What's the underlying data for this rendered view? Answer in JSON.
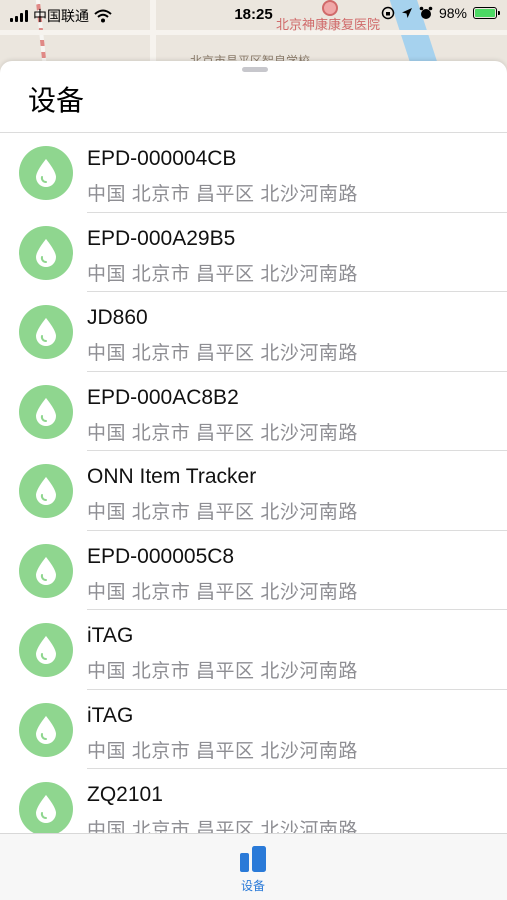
{
  "status_bar": {
    "carrier": "中国联通",
    "time": "18:25",
    "battery": "98%",
    "battery_level": 0.98
  },
  "map": {
    "poi_label": "北京神康康复医院",
    "road_label": "北京市昌平区智良学校"
  },
  "sheet": {
    "title": "设备"
  },
  "devices": [
    {
      "name": "EPD-000004CB",
      "address": "中国 北京市 昌平区 北沙河南路"
    },
    {
      "name": "EPD-000A29B5",
      "address": "中国 北京市 昌平区 北沙河南路"
    },
    {
      "name": "JD860",
      "address": "中国 北京市 昌平区 北沙河南路"
    },
    {
      "name": "EPD-000AC8B2",
      "address": "中国 北京市 昌平区 北沙河南路"
    },
    {
      "name": "ONN Item Tracker",
      "address": "中国 北京市 昌平区 北沙河南路"
    },
    {
      "name": "EPD-000005C8",
      "address": "中国 北京市 昌平区 北沙河南路"
    },
    {
      "name": "iTAG",
      "address": "中国 北京市 昌平区 北沙河南路"
    },
    {
      "name": "iTAG",
      "address": "中国 北京市 昌平区 北沙河南路"
    },
    {
      "name": "ZQ2101",
      "address": "中国 北京市 昌平区 北沙河南路"
    }
  ],
  "tab_bar": {
    "tabs": [
      {
        "label": "设备",
        "icon": "devices-icon",
        "active": true
      }
    ]
  },
  "colors": {
    "accent": "#2a7ad8",
    "avatar_green": "#8fd68f",
    "battery_green": "#4cd964"
  }
}
